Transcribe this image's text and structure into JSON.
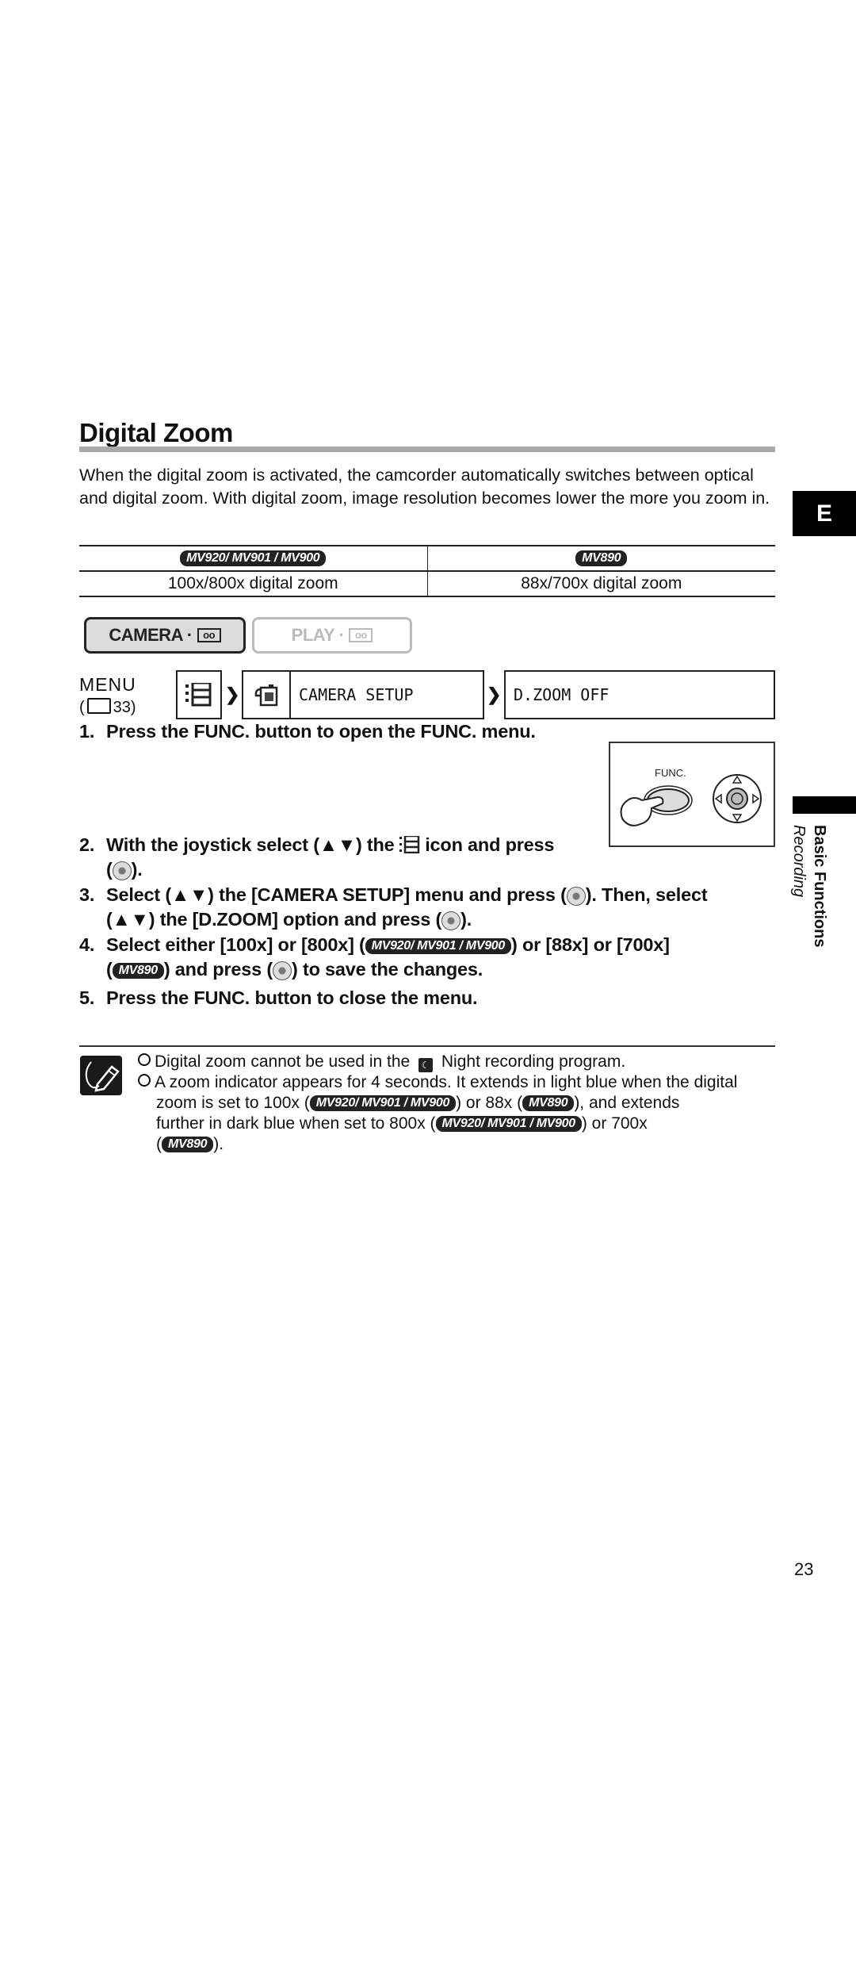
{
  "section": {
    "title": "Digital Zoom",
    "intro": "When the digital zoom is activated, the camcorder automatically switches between optical and digital zoom. With digital zoom, image resolution becomes lower the more you zoom in."
  },
  "model_table": {
    "headers": [
      "MV920/ MV901 / MV900",
      "MV890"
    ],
    "values": [
      "100x/800x digital zoom",
      "88x/700x digital zoom"
    ]
  },
  "modes": {
    "camera": "CAMERA ·",
    "play": "PLAY ·",
    "tape_glyph": "oo"
  },
  "menu_path": {
    "label": "MENU",
    "ref": "( 🕮 33)",
    "icon1": "menu-list-icon",
    "icon2": "camera-icon",
    "item": "CAMERA SETUP",
    "setting": "D.ZOOM OFF",
    "arrow": "❯"
  },
  "steps": [
    {
      "num": "1.",
      "text": "Press the FUNC. button to open the FUNC. menu."
    },
    {
      "num": "2.",
      "a": "With the joystick select (▲▼) the ",
      "b": " icon and press",
      "c": "(",
      "d": ")."
    },
    {
      "num": "3.",
      "a": "Select (▲▼) the [CAMERA SETUP] menu and press (",
      "b": "). Then, select",
      "c": "(▲▼) the [D.ZOOM] option and press (",
      "d": ")."
    },
    {
      "num": "4.",
      "a": "Select either [100x] or [800x] (",
      "b": ") or [88x] or [700x]",
      "c": "(",
      "d": ") and press (",
      "e": ") to save the changes."
    },
    {
      "num": "5.",
      "text": "Press the FUNC. button to close the menu."
    }
  ],
  "func_illustration": {
    "label": "FUNC."
  },
  "badges": {
    "multi": "MV920/ MV901 / MV900",
    "single": "MV890"
  },
  "notes": [
    {
      "a": "Digital zoom cannot be used in the ",
      "b": " Night recording program."
    },
    {
      "a": "A zoom indicator appears for 4 seconds. It extends in light blue when the digital",
      "b": "zoom is set to 100x (",
      "c": ") or 88x (",
      "d": "), and extends",
      "e": "further in dark blue when set to 800x (",
      "f": ") or 700x",
      "g": "(",
      "h": ")."
    }
  ],
  "side_tab": {
    "letter": "E",
    "section": "Basic Functions",
    "subsection": "Recording"
  },
  "page_number": "23"
}
